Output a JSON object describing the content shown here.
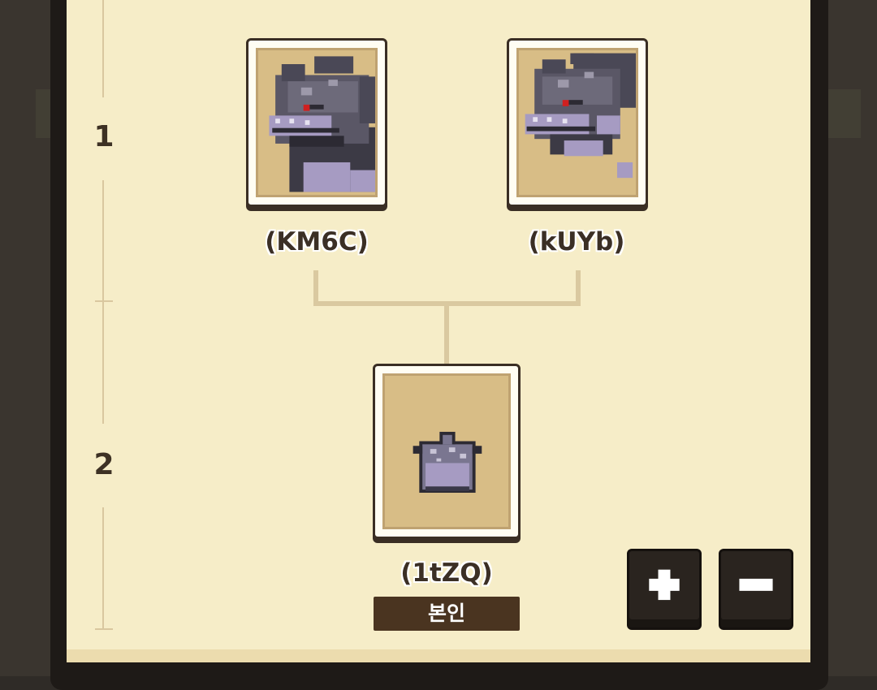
{
  "generations": [
    {
      "label": "1"
    },
    {
      "label": "2"
    }
  ],
  "parents": [
    {
      "id_label": "(KM6C)",
      "icon": "grey-dragon-portrait-icon"
    },
    {
      "id_label": "(kUYb)",
      "icon": "grey-dragon-crouching-icon"
    }
  ],
  "child": {
    "id_label": "(1tZQ)",
    "icon": "grey-dragon-egg-icon",
    "badge": "본인"
  },
  "controls": {
    "zoom_in_icon": "plus-icon",
    "zoom_out_icon": "minus-icon"
  },
  "colors": {
    "panel": "#f6edc8",
    "card_inner": "#d8bd86",
    "connector": "#dac9a0",
    "badge": "#4a3420",
    "button": "#2a241f"
  }
}
